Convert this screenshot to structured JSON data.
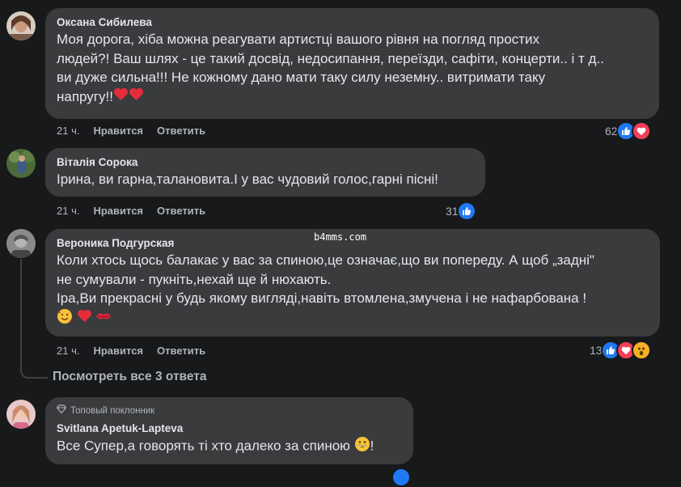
{
  "comments": [
    {
      "author": "Оксана Сибилева",
      "lines": [
        "Моя дорога, хіба можна реагувати артистці вашого рівня на погляд простих",
        "людей?! Ваш шлях - це такий досвід, недосипання, переїзди, сафіти, концерти.. і т д..",
        "ви дуже сильна!!! Не кожному дано мати таку силу неземну.. витримати таку",
        "напругу!!"
      ],
      "time": "21 ч.",
      "like_label": "Нравится",
      "reply_label": "Ответить",
      "reaction_count": "62",
      "reaction_icons": [
        "like-icon",
        "love-icon"
      ]
    },
    {
      "author": "Віталія Сорока",
      "lines": [
        "Ірина, ви гарна,талановита.І у вас чудовий голос,гарні пісні!"
      ],
      "time": "21 ч.",
      "like_label": "Нравится",
      "reply_label": "Ответить",
      "reaction_count": "31",
      "reaction_icons": [
        "like-icon"
      ]
    },
    {
      "author": "Вероника Подгурская",
      "lines": [
        "Коли хтось щось балакає у вас за спиною,це означає,що ви попереду. А щоб „задні\"",
        "не сумували - пукніть,нехай ще й нюхають.",
        "Іра,Ви прекрасні у будь якому вигляді,навіть втомлена,змучена і не нафарбована !"
      ],
      "time": "21 ч.",
      "like_label": "Нравится",
      "reply_label": "Ответить",
      "reaction_count": "13",
      "reaction_icons": [
        "like-icon",
        "love-icon",
        "wow-icon"
      ]
    },
    {
      "badge": "Топовый поклонник",
      "author": "Svitlana Apetuk-Lapteva",
      "lines": [
        "Все Супер,а говорять ті хто далеко за спиною"
      ],
      "trailing_text": "!"
    }
  ],
  "view_replies": "Посмотреть все 3 ответа",
  "watermark": "b4mms.com",
  "colors": {
    "background": "#18191a",
    "bubble": "#3a3b3c",
    "text": "#e4e6eb",
    "secondary": "#b0b3b8",
    "like": "#2078f4",
    "love": "#f33e58",
    "wow": "#f7b125"
  }
}
